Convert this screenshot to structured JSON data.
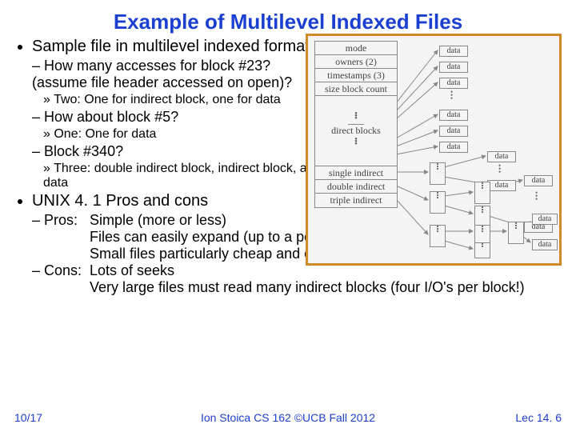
{
  "title": "Example of Multilevel Indexed Files",
  "bullets": {
    "b1": "Sample file in multilevel indexed format:",
    "b1a": "How many accesses for block #23? (assume file header accessed on open)?",
    "b1a1": "Two: One for indirect block, one for data",
    "b1b": "How about block #5?",
    "b1b1": "One: One for data",
    "b1c": "Block #340?",
    "b1c1": "Three: double indirect block, indirect block, and data",
    "b2": "UNIX 4. 1 Pros and cons",
    "pros_label": "Pros:",
    "pros_text": "Simple (more or less)\nFiles can easily expand (up to a point)\nSmall files particularly cheap and easy",
    "cons_label": "Cons:",
    "cons_text": "Lots of seeks\nVery large files must read many indirect blocks (four I/O's per block!)"
  },
  "diagram": {
    "inode": {
      "mode": "mode",
      "owners": "owners (2)",
      "timestamps": "timestamps (3)",
      "size_block": "size block count",
      "direct": "direct blocks",
      "single": "single indirect",
      "double": "double indirect",
      "triple": "triple indirect"
    },
    "data": "data"
  },
  "footer": {
    "left": "10/17",
    "center": "Ion Stoica CS 162 ©UCB Fall 2012",
    "right": "Lec 14. 6"
  }
}
